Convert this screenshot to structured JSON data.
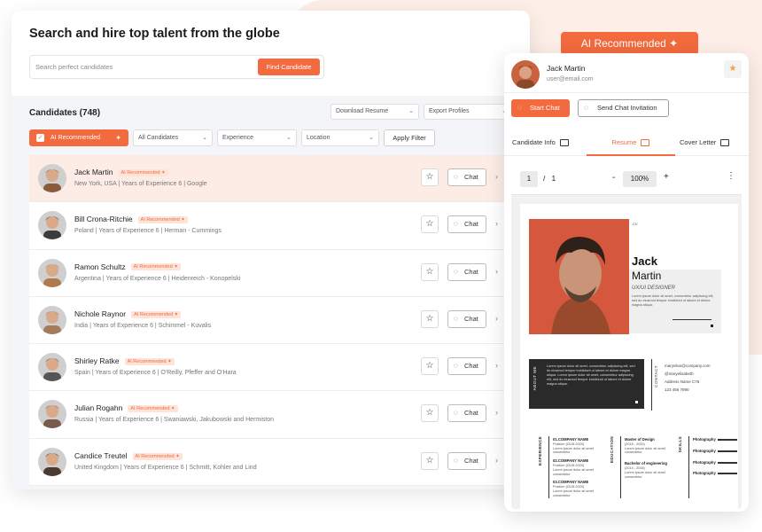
{
  "main": {
    "title": "Search and hire top talent from the globe",
    "search_placeholder": "Search perfect candidates",
    "find_button": "Find Candidate",
    "candidates_count": "Candidates (748)",
    "download_resume": "Download Resume",
    "export_profiles": "Export Profiles",
    "filters": {
      "ai_recommended": "AI Recommended",
      "all_candidates": "All Candidates",
      "experience": "Experience",
      "location": "Location",
      "apply": "Apply Filter"
    },
    "ai_tag": "AI Recommended",
    "chat_label": "Chat",
    "candidates": [
      {
        "name": "Jack Martin",
        "meta": "New York, USA  |  Years of Experience 6  |  Google",
        "active": true,
        "tone": "#8a5a3a"
      },
      {
        "name": "Bill Crona-Ritchie",
        "meta": "Poland  |  Years of Experience 6  |  Herman - Cummings",
        "active": false,
        "tone": "#3c3c3c"
      },
      {
        "name": "Ramon Schultz",
        "meta": "Argentina  |  Years of Experience 6  |  Heidenreich - Konopelski",
        "active": false,
        "tone": "#b07a4e"
      },
      {
        "name": "Nichole Raynor",
        "meta": "India  |  Years of Experience 6  |  Schimmel - Kuvalis",
        "active": false,
        "tone": "#a67b5b"
      },
      {
        "name": "Shirley Ratke",
        "meta": "Spain  |  Years of Experience 6  |  O'Reilly, Pfeffer and O'Hara",
        "active": false,
        "tone": "#555555"
      },
      {
        "name": "Julian Rogahn",
        "meta": "Russia  |  Years of Experience 6  |  Swaniawski, Jakubowski and Hermiston",
        "active": false,
        "tone": "#7a5a4a"
      },
      {
        "name": "Candice Treutel",
        "meta": "United Kingdom  |  Years of Experience 6  |  Schmitt, Kohler and Lind",
        "active": false,
        "tone": "#4a3a30"
      }
    ]
  },
  "side": {
    "banner": "AI Recommended",
    "name": "Jack Martin",
    "email": "user@email.com",
    "start_chat": "Start Chat",
    "send_invitation": "Send Chat Invitation",
    "tabs": [
      "Candidate Info",
      "Resume",
      "Cover Letter"
    ],
    "page_current": "1",
    "page_sep": "/",
    "page_total": "1",
    "zoom": "100%",
    "resume": {
      "cv_mark": "CV",
      "first_name": "Jack",
      "last_name": "Martin",
      "role": "UX/UI DESIGNER",
      "blurb": "Lorem ipsum dolor sit amet, consectetur adipiscing elit, sed do eiusmod tempor incididunt ut labore et dolore magna aliqua.",
      "about_label": "ABOUT ME",
      "about_text": "Lorem ipsum dolor sit amet, consectetur adipiscing elit, sed do eiusmod tempor incididunt ut labore et dolore magna aliqua. Lorem ipsum dolor sit amet, consectetur adipiscing elit, sed do eiusmod tempor incididunt ut labore et dolore magna aliqua.",
      "contact_label": "CONTACT",
      "contact": [
        "maryelius@company.com",
        "@maryelisabeth",
        "Address Name C76",
        "123 456 7890"
      ],
      "experience_label": "EXPERIENCE",
      "experience": [
        {
          "title": "01.COMPANY NAME",
          "sub": "Position (2018-2020)",
          "desc": "Lorem ipsum dolor sit amet consectetur"
        },
        {
          "title": "02.COMPANY NAME",
          "sub": "Position (2018-2020)",
          "desc": "Lorem ipsum dolor sit amet consectetur"
        },
        {
          "title": "03.COMPANY NAME",
          "sub": "Position (2018-2020)",
          "desc": "Lorem ipsum dolor sit amet consectetur"
        }
      ],
      "education_label": "EDUCATION",
      "education": [
        {
          "title": "Master of Design",
          "sub": "(2018 - 2020)",
          "desc": "Lorem ipsum dolor sit amet consectetur"
        },
        {
          "title": "Bachelor of engineering",
          "sub": "(2014 - 2018)",
          "desc": "Lorem ipsum dolor sit amet consectetur"
        }
      ],
      "skills_label": "SKILLS",
      "skills": [
        "Photography",
        "Photography",
        "Photography",
        "Photography"
      ]
    }
  },
  "colors": {
    "accent": "#f26a3d",
    "accent_light": "#fdece6",
    "bg_blob": "#fdeee8"
  }
}
